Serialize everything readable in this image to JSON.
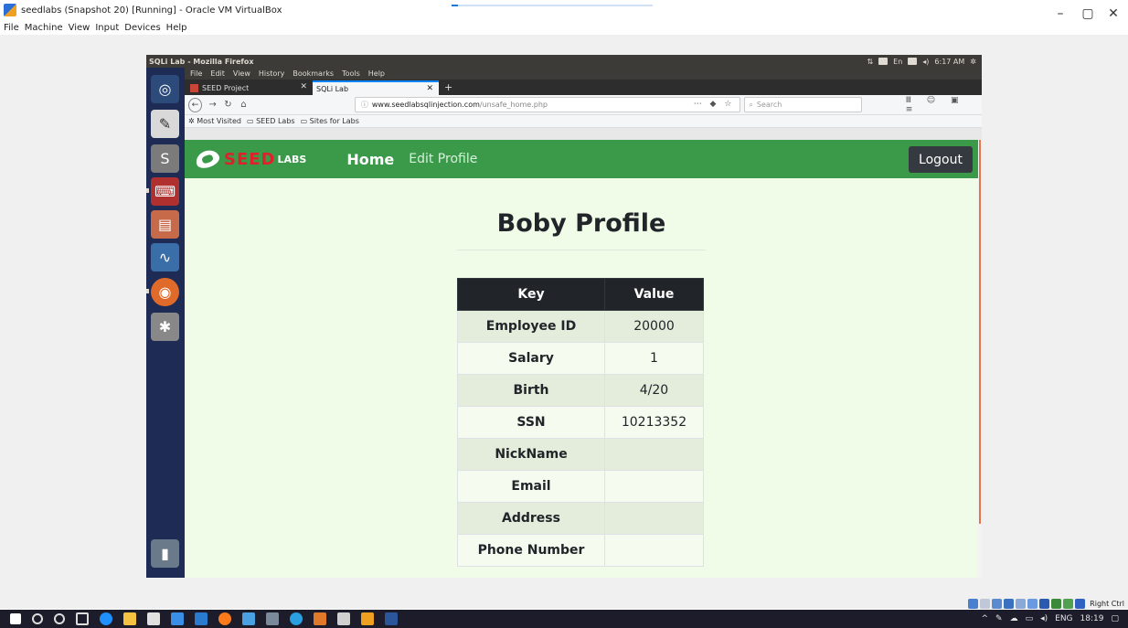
{
  "host": {
    "window_title": "seedlabs (Snapshot 20) [Running] - Oracle VM VirtualBox",
    "menu": [
      "File",
      "Machine",
      "View",
      "Input",
      "Devices",
      "Help"
    ],
    "progress_fraction": 0.03,
    "status_right_ctrl": "Right Ctrl",
    "taskbar": {
      "language": "ENG",
      "time": "18:19"
    }
  },
  "guest": {
    "topbar_title": "SQLi Lab - Mozilla Firefox",
    "tray": {
      "lang": "En",
      "time": "6:17 AM"
    }
  },
  "browser": {
    "menu": [
      "File",
      "Edit",
      "View",
      "History",
      "Bookmarks",
      "Tools",
      "Help"
    ],
    "tabs": [
      {
        "title": "SEED Project",
        "active": false
      },
      {
        "title": "SQLi Lab",
        "active": true
      }
    ],
    "url_host": "www.seedlabsqlinjection.com",
    "url_path": "/unsafe_home.php",
    "search_placeholder": "Search",
    "bookmarks": [
      "Most Visited",
      "SEED Labs",
      "Sites for Labs"
    ]
  },
  "site": {
    "logo_seed": "SEED",
    "logo_labs": "LABS",
    "nav_home": "Home",
    "nav_edit": "Edit Profile",
    "logout": "Logout"
  },
  "profile": {
    "title": "Boby Profile",
    "header_key": "Key",
    "header_value": "Value",
    "rows": [
      {
        "key": "Employee ID",
        "value": "20000"
      },
      {
        "key": "Salary",
        "value": "1"
      },
      {
        "key": "Birth",
        "value": "4/20"
      },
      {
        "key": "SSN",
        "value": "10213352"
      },
      {
        "key": "NickName",
        "value": ""
      },
      {
        "key": "Email",
        "value": ""
      },
      {
        "key": "Address",
        "value": ""
      },
      {
        "key": "Phone Number",
        "value": ""
      }
    ]
  }
}
